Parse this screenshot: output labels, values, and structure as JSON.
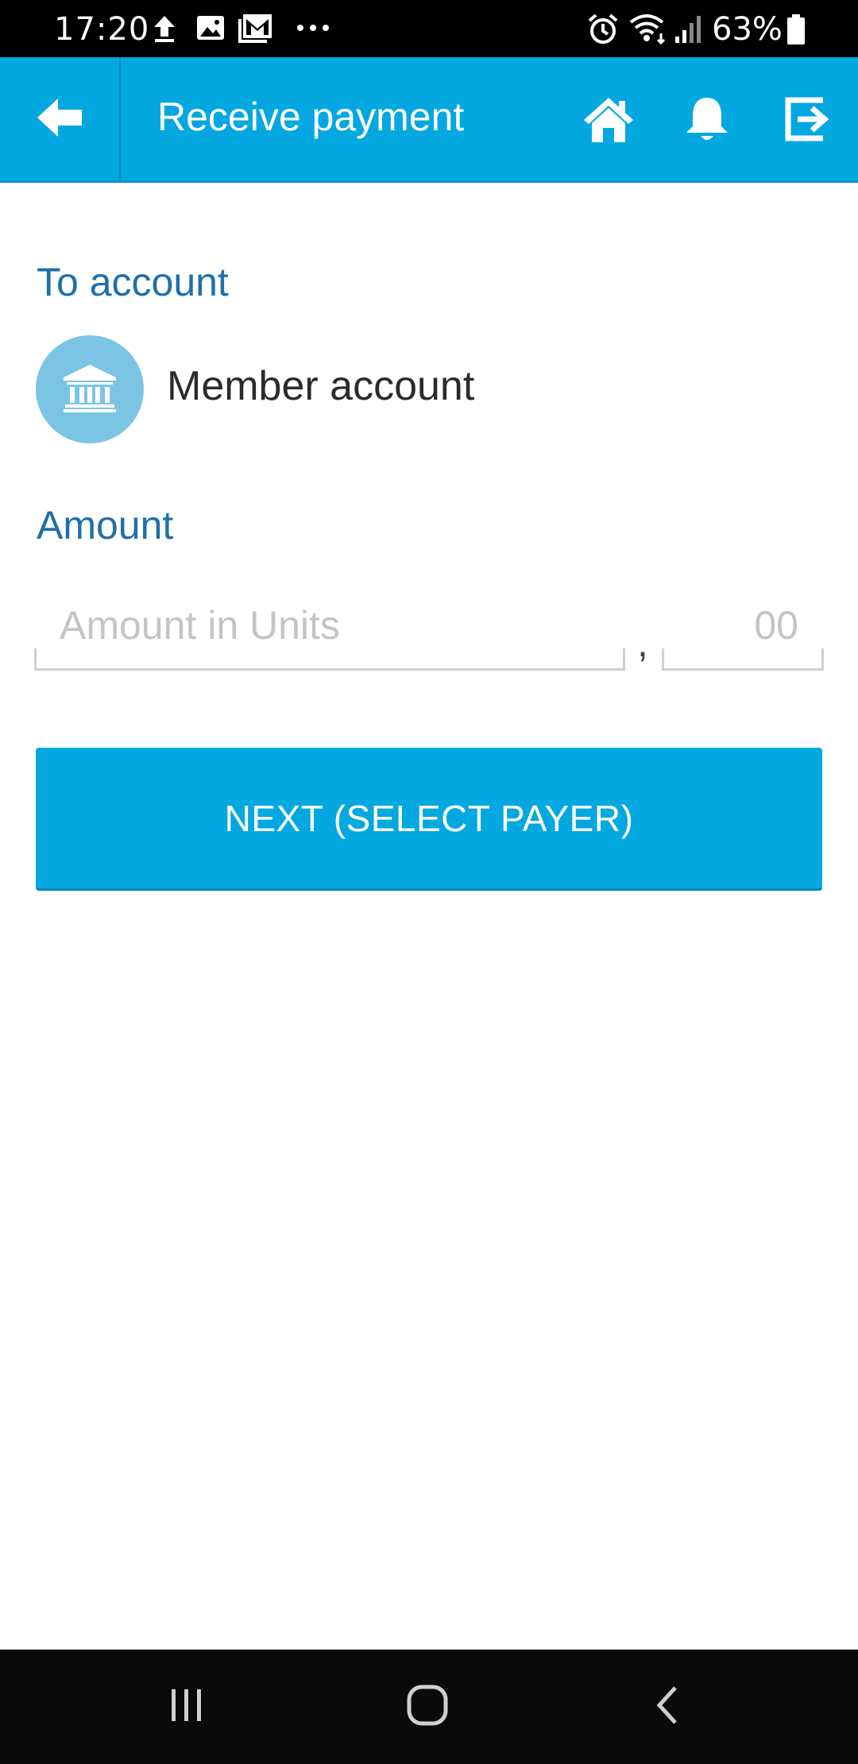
{
  "status_bar": {
    "time": "17:20",
    "battery": "63%",
    "icons": [
      "upload-icon",
      "image-icon",
      "gmail-icon",
      "more-dots-icon",
      "alarm-icon",
      "wifi-icon",
      "signal-icon",
      "battery-icon"
    ]
  },
  "app_bar": {
    "title": "Receive payment",
    "background": "#03a8e0",
    "icons": [
      "back-arrow-icon",
      "home-icon",
      "bell-icon",
      "logout-icon"
    ]
  },
  "to_account": {
    "label": "To account",
    "account_name": "Member account",
    "icon": "bank-icon"
  },
  "amount": {
    "label": "Amount",
    "units_placeholder": "Amount in Units",
    "units_value": "",
    "decimal_separator": ",",
    "decimals_placeholder": "00",
    "decimals_value": ""
  },
  "next_button": {
    "label": "NEXT (SELECT PAYER)"
  },
  "nav_bar": {
    "icons": [
      "recent-apps-icon",
      "home-circle-icon",
      "back-chevron-icon"
    ]
  }
}
